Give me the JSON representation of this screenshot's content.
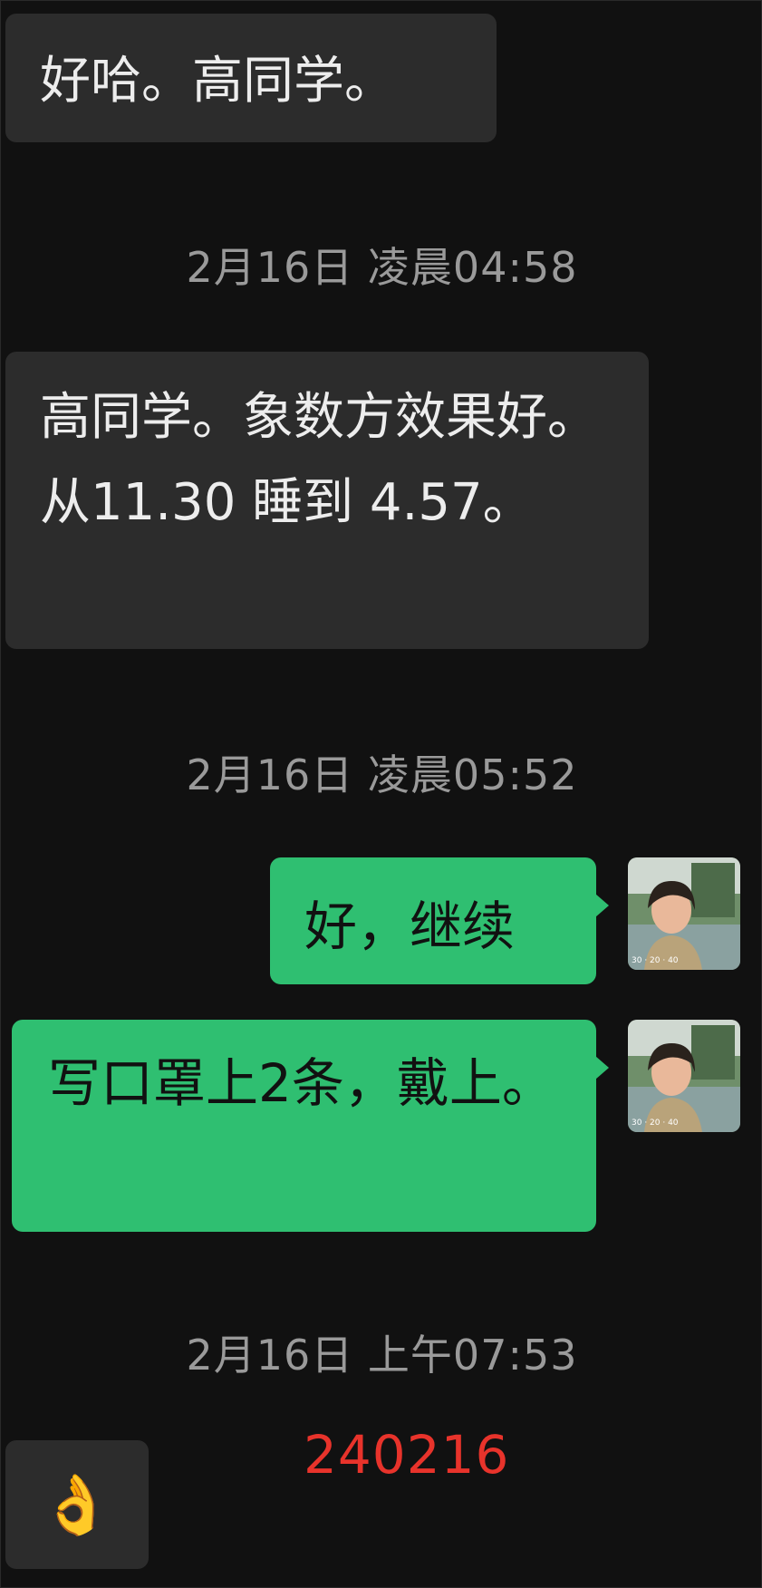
{
  "messages": [
    {
      "side": "in",
      "text": "好哈。高同学。"
    },
    {
      "side": "timestamp",
      "text": "2月16日 凌晨04:58"
    },
    {
      "side": "in",
      "text": "高同学。象数方效果好。从11.30 睡到 4.57。"
    },
    {
      "side": "timestamp",
      "text": "2月16日 凌晨05:52"
    },
    {
      "side": "out",
      "text": "好，继续"
    },
    {
      "side": "out",
      "text": "写口罩上2条，戴上。"
    },
    {
      "side": "timestamp",
      "text": "2月16日 上午07:53"
    },
    {
      "side": "in",
      "text": "👌"
    }
  ],
  "overlay_code": "240216",
  "avatar_caption": "30 · 20 · 40",
  "colors": {
    "background": "#111111",
    "incoming_bubble": "#2c2c2c",
    "outgoing_bubble": "#2fbf71",
    "timestamp": "#9a9a9a",
    "overlay_code": "#e8332b"
  }
}
